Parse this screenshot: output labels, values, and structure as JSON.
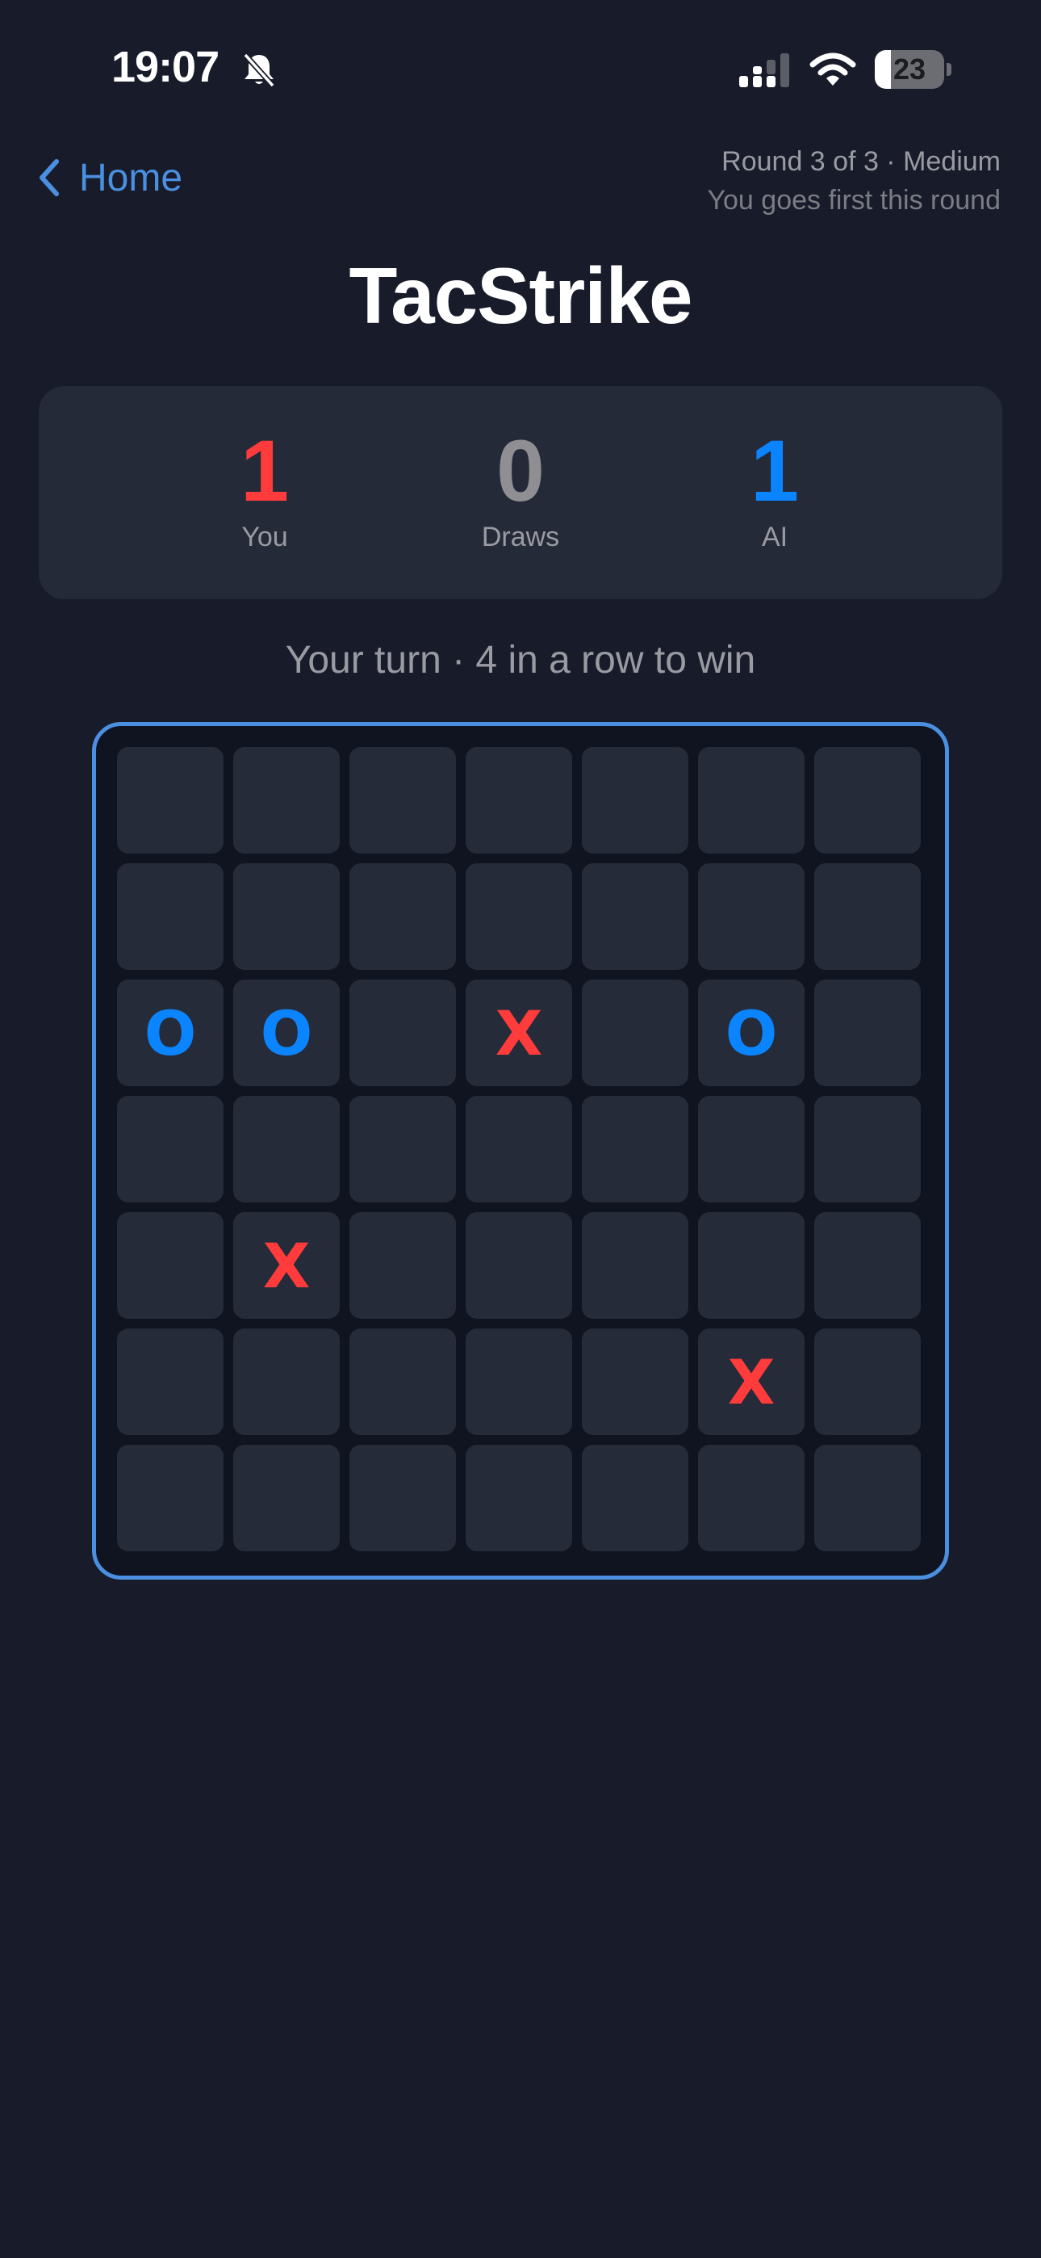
{
  "status_bar": {
    "time": "19:07",
    "battery_level": "23",
    "battery_fraction": 0.23,
    "icons": [
      "bell-slash-icon",
      "cellular-signal-icon",
      "wifi-icon",
      "battery-icon"
    ]
  },
  "header": {
    "back_label": "Home",
    "round_info": "Round 3 of 3 · Medium",
    "first_player_info": "You goes first this round"
  },
  "title": "TacStrike",
  "scoreboard": {
    "you": {
      "value": "1",
      "label": "You",
      "color": "#ff3b3b"
    },
    "draws": {
      "value": "0",
      "label": "Draws",
      "color": "#8e8e93"
    },
    "ai": {
      "value": "1",
      "label": "AI",
      "color": "#0a84ff"
    }
  },
  "turn_status": "Your turn · 4 in a row to win",
  "board": {
    "size": 7,
    "cells": [
      [
        "",
        "",
        "",
        "",
        "",
        "",
        ""
      ],
      [
        "",
        "",
        "",
        "",
        "",
        "",
        ""
      ],
      [
        "O",
        "O",
        "",
        "X",
        "",
        "O",
        ""
      ],
      [
        "",
        "",
        "",
        "",
        "",
        "",
        ""
      ],
      [
        "",
        "X",
        "",
        "",
        "",
        "",
        ""
      ],
      [
        "",
        "",
        "",
        "",
        "",
        "X",
        ""
      ],
      [
        "",
        "",
        "",
        "",
        "",
        "",
        ""
      ]
    ]
  },
  "colors": {
    "background": "#181c2a",
    "accent": "#4a8fe0",
    "x_mark": "#ff3b3b",
    "o_mark": "#0a84ff"
  }
}
